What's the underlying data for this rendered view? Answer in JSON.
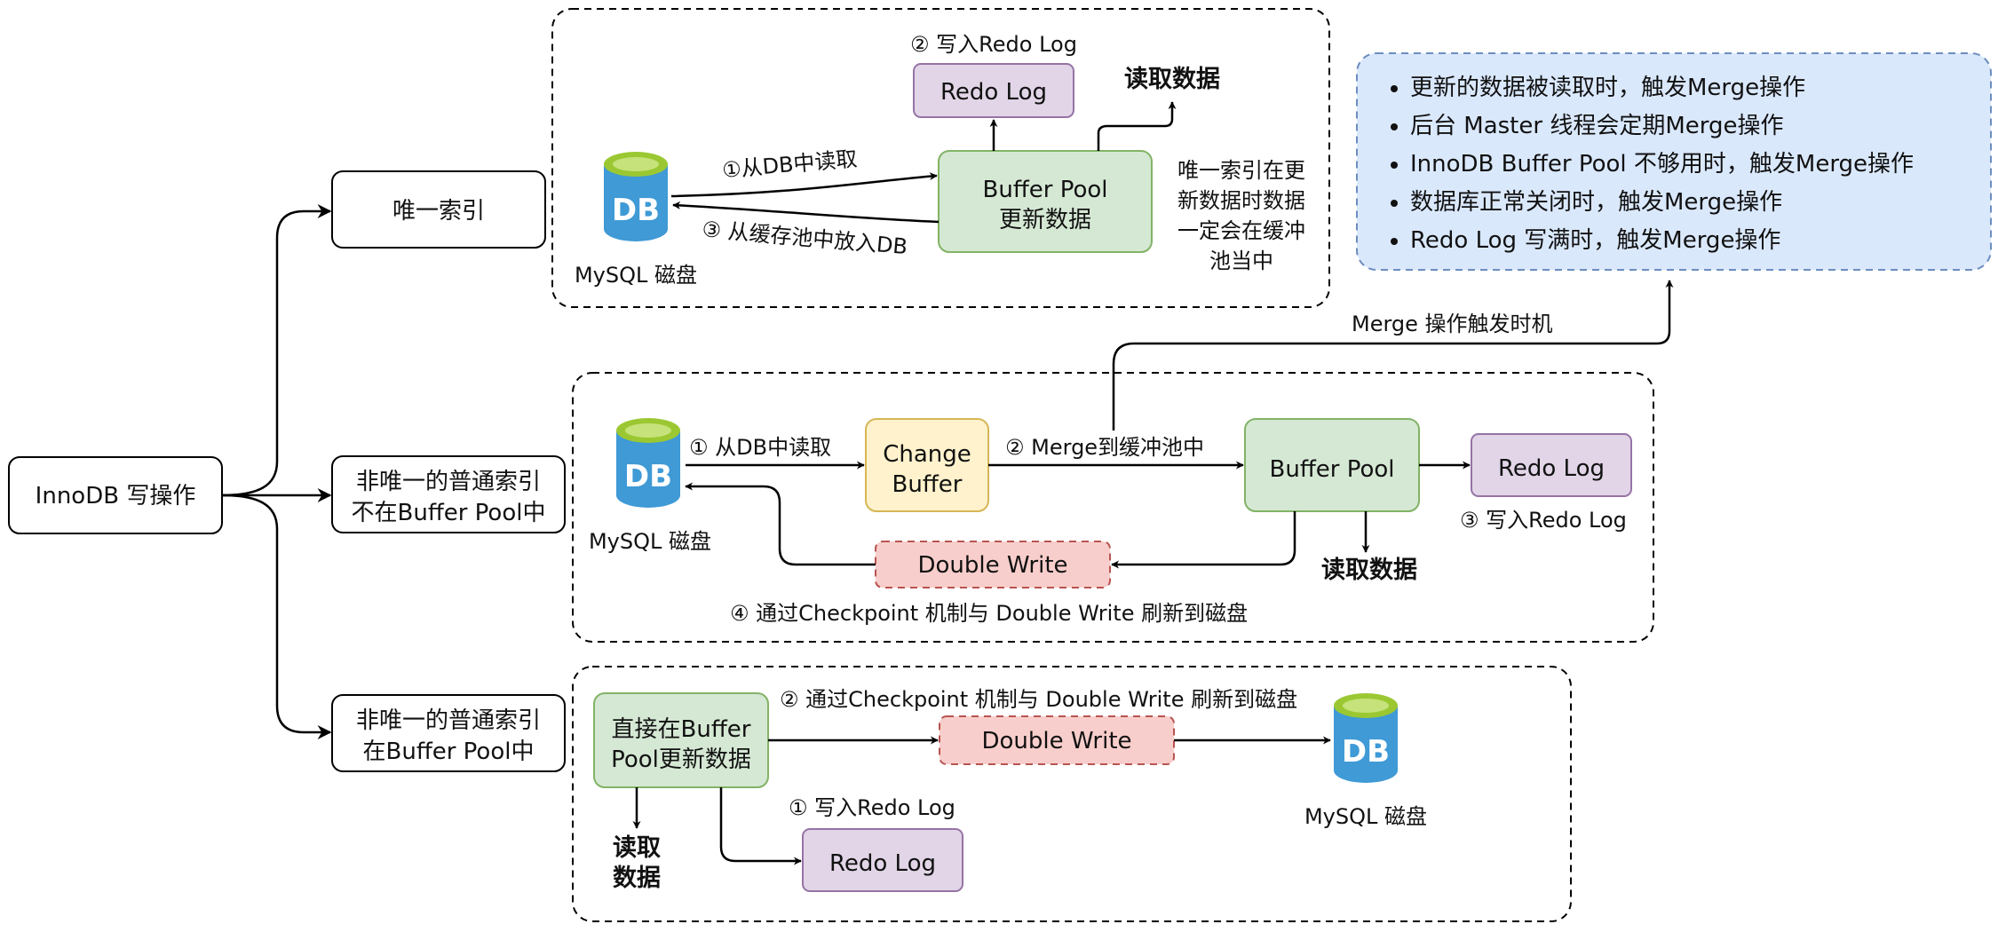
{
  "root": {
    "label": "InnoDB 写操作"
  },
  "branches": {
    "unique": "唯一索引",
    "nonunique_not_in_pool": [
      "非唯一的普通索引",
      "不在Buffer Pool中"
    ],
    "nonunique_in_pool": [
      "非唯一的普通索引",
      "在Buffer Pool中"
    ]
  },
  "section1": {
    "db_glyph": "DB",
    "db_label": "MySQL 磁盘",
    "redo_log": "Redo Log",
    "buffer_pool": [
      "Buffer Pool",
      "更新数据"
    ],
    "step1": "①从DB中读取",
    "step2": "② 写入Redo Log",
    "step3": "③ 从缓存池中放入DB",
    "read_data": "读取数据",
    "note": [
      "唯一索引在更",
      "新数据时数据",
      "一定会在缓冲",
      "池当中"
    ]
  },
  "merge_timing": {
    "label": "Merge 操作触发时机",
    "items": [
      "更新的数据被读取时，触发Merge操作",
      "后台 Master 线程会定期Merge操作",
      "InnoDB Buffer Pool 不够用时，触发Merge操作",
      "数据库正常关闭时，触发Merge操作",
      "Redo Log 写满时，触发Merge操作"
    ]
  },
  "section2": {
    "db_glyph": "DB",
    "db_label": "MySQL 磁盘",
    "change_buffer": [
      "Change",
      "Buffer"
    ],
    "buffer_pool": "Buffer Pool",
    "redo_log": "Redo Log",
    "double_write": "Double Write",
    "step1": "① 从DB中读取",
    "step2": "② Merge到缓冲池中",
    "step3": "③ 写入Redo Log",
    "step4": "④ 通过Checkpoint 机制与 Double Write 刷新到磁盘",
    "read_data": "读取数据"
  },
  "section3": {
    "update_box": [
      "直接在Buffer",
      "Pool更新数据"
    ],
    "double_write": "Double Write",
    "redo_log": "Redo Log",
    "db_glyph": "DB",
    "db_label": "MySQL 磁盘",
    "step1": "① 写入Redo Log",
    "step2": "② 通过Checkpoint 机制与 Double Write 刷新到磁盘",
    "read_data": [
      "读取",
      "数据"
    ]
  },
  "colors": {
    "green_fill": "#d5e8d4",
    "green_stroke": "#82b366",
    "purple_fill": "#e1d5e7",
    "purple_stroke": "#9673a6",
    "yellow_fill": "#fff2cc",
    "yellow_stroke": "#d6b656",
    "red_fill": "#f8cecc",
    "red_stroke": "#b85450",
    "blue_fill": "#dae8fc",
    "blue_stroke": "#6c8ebf",
    "db_top": "#9bc832",
    "db_body": "#3f9ad6"
  }
}
